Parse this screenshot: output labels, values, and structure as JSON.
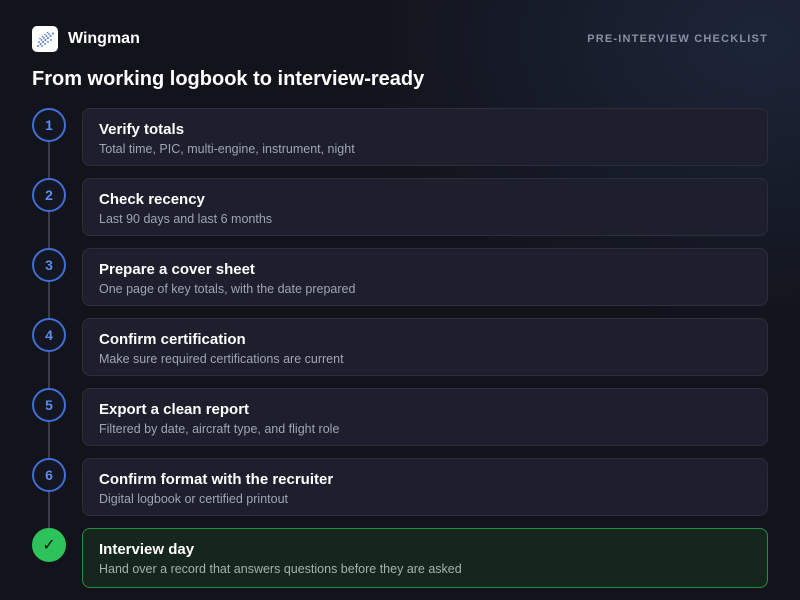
{
  "app": {
    "name": "Wingman",
    "logo_icon": "wing-logo-icon"
  },
  "header": {
    "eyebrow": "PRE-INTERVIEW CHECKLIST"
  },
  "page": {
    "title": "From working logbook to interview-ready"
  },
  "steps": [
    {
      "number": "1",
      "title": "Verify totals",
      "subtitle": "Total time, PIC, multi-engine, instrument, night"
    },
    {
      "number": "2",
      "title": "Check recency",
      "subtitle": "Last 90 days and last 6 months"
    },
    {
      "number": "3",
      "title": "Prepare a cover sheet",
      "subtitle": "One page of key totals, with the date prepared"
    },
    {
      "number": "4",
      "title": "Confirm certification",
      "subtitle": "Make sure required certifications are current"
    },
    {
      "number": "5",
      "title": "Export a clean report",
      "subtitle": "Filtered by date, aircraft type, and flight role"
    },
    {
      "number": "6",
      "title": "Confirm format with the recruiter",
      "subtitle": "Digital logbook or certified printout"
    }
  ],
  "final_step": {
    "marker": "✓",
    "title": "Interview day",
    "subtitle": "Hand over a record that answers questions before they are asked",
    "icon": "checkmark-icon"
  },
  "colors": {
    "background": "#12131b",
    "accent_blue": "#3f6fd6",
    "success_green": "#2ec25a",
    "card": "#1d1f2c"
  }
}
